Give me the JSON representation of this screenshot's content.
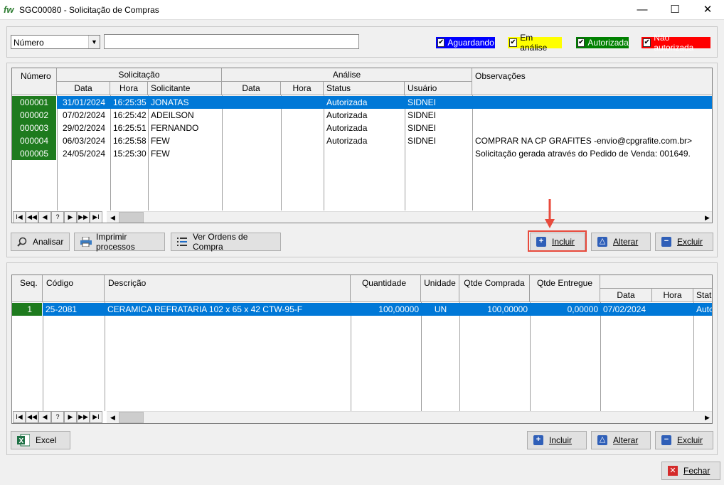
{
  "window": {
    "logo": "fw",
    "title": "SGC00080 - Solicitação de Compras",
    "minimize": "—",
    "maximize": "☐",
    "close": "✕"
  },
  "filter": {
    "field": "Número",
    "search_value": "",
    "legend": [
      {
        "label": "Aguardando",
        "bg": "#0000ff",
        "fg": "#ffffff",
        "checked": true
      },
      {
        "label": "Em análise",
        "bg": "#ffff00",
        "fg": "#000000",
        "checked": true
      },
      {
        "label": "Autorizada",
        "bg": "#008000",
        "fg": "#ffffff",
        "checked": true
      },
      {
        "label": "Não autorizada",
        "bg": "#ff0000",
        "fg": "#ffffff",
        "checked": true
      }
    ]
  },
  "top_grid": {
    "headers": {
      "numero": "Número",
      "solicitacao": "Solicitação",
      "data": "Data",
      "hora": "Hora",
      "solicitante": "Solicitante",
      "analise": "Análise",
      "a_data": "Data",
      "a_hora": "Hora",
      "status": "Status",
      "usuario": "Usuário",
      "observacoes": "Observações"
    },
    "rows": [
      {
        "numero": "000001",
        "data": "31/01/2024",
        "hora": "16:25:35",
        "solicitante": "JONATAS",
        "a_data": "",
        "a_hora": "",
        "status": "Autorizada",
        "usuario": "SIDNEI",
        "obs": ""
      },
      {
        "numero": "000002",
        "data": "07/02/2024",
        "hora": "16:25:42",
        "solicitante": "ADEILSON",
        "a_data": "",
        "a_hora": "",
        "status": "Autorizada",
        "usuario": "SIDNEI",
        "obs": ""
      },
      {
        "numero": "000003",
        "data": "29/02/2024",
        "hora": "16:25:51",
        "solicitante": "FERNANDO",
        "a_data": "",
        "a_hora": "",
        "status": "Autorizada",
        "usuario": "SIDNEI",
        "obs": ""
      },
      {
        "numero": "000004",
        "data": "06/03/2024",
        "hora": "16:25:58",
        "solicitante": "FEW",
        "a_data": "",
        "a_hora": "",
        "status": "Autorizada",
        "usuario": "SIDNEI",
        "obs": "COMPRAR NA CP GRAFITES -envio@cpgrafite.com.br>"
      },
      {
        "numero": "000005",
        "data": "24/05/2024",
        "hora": "15:25:30",
        "solicitante": "FEW",
        "a_data": "",
        "a_hora": "",
        "status": "Autorizada",
        "usuario": "",
        "obs": "Solicitação gerada através do Pedido de Venda: 001649."
      }
    ]
  },
  "nav": [
    "I◀",
    "◀◀",
    "◀",
    "?",
    "▶",
    "▶▶",
    "▶I"
  ],
  "top_buttons": {
    "analisar": "Analisar",
    "imprimir": "Imprimir processos",
    "ver_ordens": "Ver Ordens de Compra",
    "incluir": "Incluir",
    "alterar": "Alterar",
    "excluir": "Excluir"
  },
  "bottom_grid": {
    "headers": {
      "seq": "Seq.",
      "codigo": "Código",
      "descricao": "Descrição",
      "quantidade": "Quantidade",
      "unidade": "Unidade",
      "qtde_comprada": "Qtde Comprada",
      "qtde_entregue": "Qtde Entregue",
      "data": "Data",
      "hora": "Hora",
      "status": "Stat"
    },
    "rows": [
      {
        "seq": "1",
        "codigo": "25-2081",
        "descricao": "CERAMICA REFRATARIA 102 x 65 x 42 CTW-95-F",
        "quantidade": "100,00000",
        "unidade": "UN",
        "qtde_comprada": "100,00000",
        "qtde_entregue": "0,00000",
        "data": "07/02/2024",
        "hora": "",
        "status": "Auto"
      }
    ]
  },
  "bottom_buttons": {
    "excel": "Excel",
    "incluir": "Incluir",
    "alterar": "Alterar",
    "excluir": "Excluir",
    "fechar": "Fechar"
  }
}
